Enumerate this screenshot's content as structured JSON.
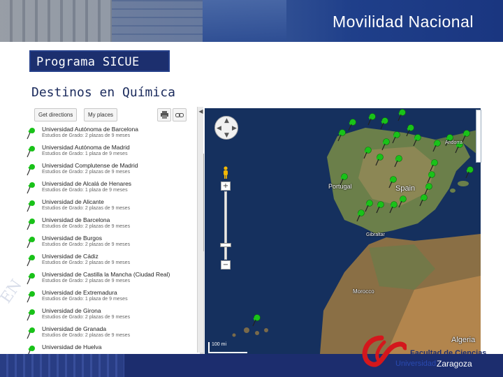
{
  "header": {
    "title": "Movilidad Nacional"
  },
  "section": {
    "label": "Programa SICUE"
  },
  "subtitle": "Destinos en Química",
  "maps_panel": {
    "toolbar": {
      "directions_label": "Get directions",
      "myplaces_label": "My places"
    },
    "results": [
      {
        "name": "Universidad Autónoma de Barcelona",
        "detail": "Estudios de Grado: 2 plazas de 9 meses"
      },
      {
        "name": "Universidad Autónoma de Madrid",
        "detail": "Estudios de Grado: 1 plaza de 9 meses"
      },
      {
        "name": "Universidad Complutense de Madrid",
        "detail": "Estudios de Grado: 2 plazas de 9 meses"
      },
      {
        "name": "Universidad de Alcalá de Henares",
        "detail": "Estudios de Grado: 1 plaza de 9 meses"
      },
      {
        "name": "Universidad de Alicante",
        "detail": "Estudios de Grado: 2 plazas de 9 meses"
      },
      {
        "name": "Universidad de Barcelona",
        "detail": "Estudios de Grado: 2 plazas de 9 meses"
      },
      {
        "name": "Universidad de Burgos",
        "detail": "Estudios de Grado: 2 plazas de 9 meses"
      },
      {
        "name": "Universidad de Cádiz",
        "detail": "Estudios de Grado: 2 plazas de 9 meses"
      },
      {
        "name": "Universidad de Castilla la Mancha (Ciudad Real)",
        "detail": "Estudios de Grado: 2 plazas de 9 meses"
      },
      {
        "name": "Universidad de Extremadura",
        "detail": "Estudios de Grado: 1 plaza de 9 meses"
      },
      {
        "name": "Universidad de Girona",
        "detail": "Estudios de Grado: 2 plazas de 9 meses"
      },
      {
        "name": "Universidad de Granada",
        "detail": "Estudios de Grado: 2 plazas de 9 meses"
      },
      {
        "name": "Universidad de Huelva",
        "detail": ""
      }
    ]
  },
  "map": {
    "labels": {
      "portugal": "Portugal",
      "spain": "Spain",
      "andorra": "Andorra",
      "gibraltar": "Gibraltar",
      "morocco": "Morocco",
      "algeria": "Algeria"
    },
    "scale_text": "100 mi",
    "pin_color": "#19c219",
    "ocean_color": "#15305e",
    "land_color": "#6b7f4a"
  },
  "footer": {
    "logo_line1": "Facultad de Ciencias",
    "logo_line2a": "Universidad",
    "logo_line2b": "Zaragoza",
    "logo_color": "#d4171c"
  }
}
